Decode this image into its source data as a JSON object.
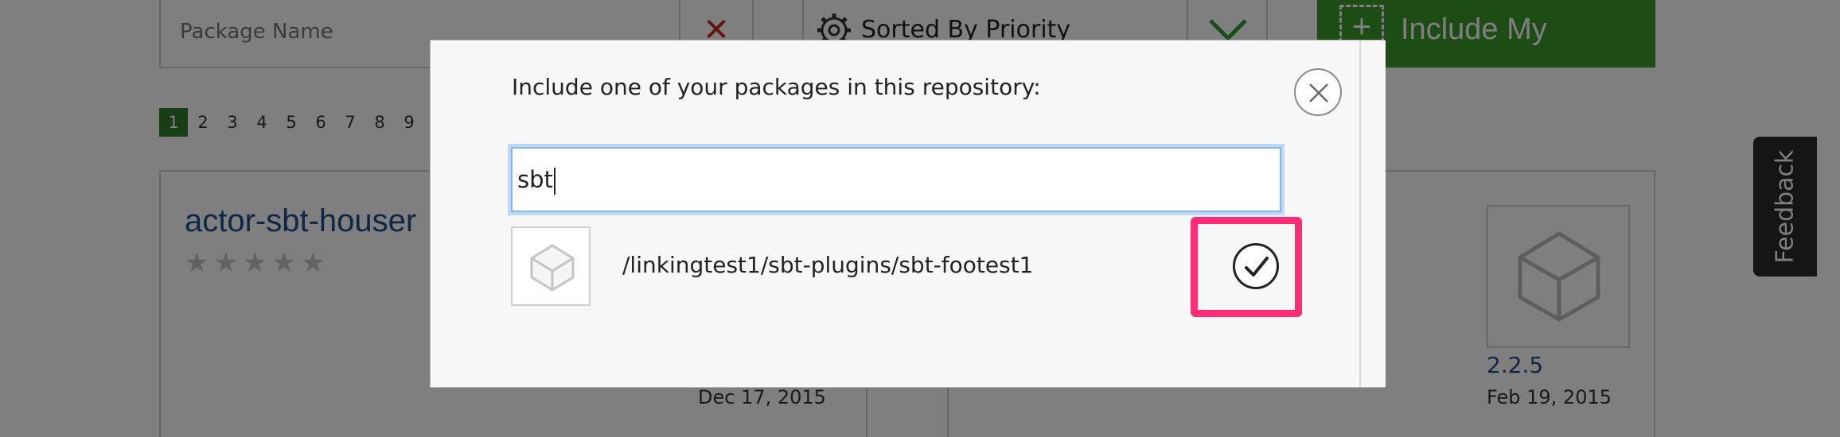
{
  "filter_bar": {
    "name_placeholder": "Package Name",
    "clear_glyph": "✕",
    "sort_label": "Sorted By Priority",
    "include_button_label": "Include My Package"
  },
  "pagination": [
    "1",
    "2",
    "3",
    "4",
    "5",
    "6",
    "7",
    "8",
    "9"
  ],
  "cards": [
    {
      "title": "actor-sbt-houser",
      "date": "Dec 17, 2015",
      "rating_stars": 0,
      "max_stars": 5
    },
    {
      "version": "2.2.5",
      "date": "Feb 19, 2015"
    }
  ],
  "feedback_label": "Feedback",
  "modal": {
    "heading": "Include one of your packages in this repository:",
    "search_value": "sbt",
    "results": [
      {
        "path": "/linkingtest1/sbt-plugins/sbt-footest1",
        "icon": "package-box-icon"
      }
    ],
    "close_icon": "close-icon",
    "select_icon": "check-circle-icon"
  },
  "colors": {
    "include_button": "#3b9a2b",
    "active_page": "#2e7d2e",
    "highlight": "#ff2d75",
    "link": "#1f4e8c",
    "focus_ring": "#7fb7f0"
  }
}
